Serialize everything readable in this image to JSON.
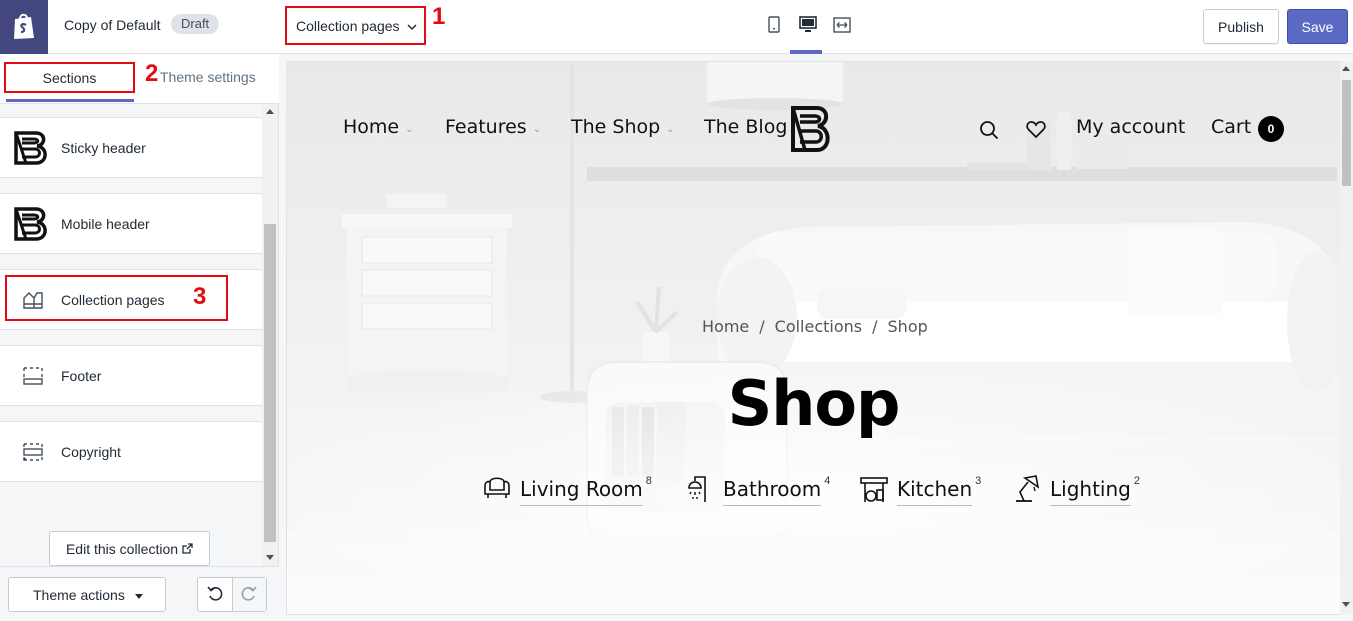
{
  "header": {
    "theme_name": "Copy of Default",
    "draft_label": "Draft",
    "page_selector": "Collection pages",
    "publish_label": "Publish",
    "save_label": "Save",
    "annotations": [
      "1",
      "2",
      "3"
    ],
    "icons": [
      "shopify-bag-icon",
      "mobile-view-icon",
      "desktop-view-icon",
      "fullscreen-view-icon"
    ]
  },
  "sidebar": {
    "tab_sections": "Sections",
    "tab_theme_settings": "Theme settings",
    "items": [
      {
        "label": "Sticky header",
        "icon": "brand-logo-icon"
      },
      {
        "label": "Mobile header",
        "icon": "brand-logo-icon"
      },
      {
        "label": "Collection pages",
        "icon": "collection-icon"
      },
      {
        "label": "Footer",
        "icon": "footer-icon"
      },
      {
        "label": "Copyright",
        "icon": "copyright-icon"
      }
    ],
    "edit_collection": "Edit this collection",
    "theme_actions": "Theme actions"
  },
  "preview": {
    "nav": [
      "Home",
      "Features",
      "The Shop",
      "The Blog"
    ],
    "my_account": "My account",
    "cart_label": "Cart",
    "cart_count": "0",
    "breadcrumb": [
      "Home",
      "/",
      "Collections",
      "/",
      "Shop"
    ],
    "title": "Shop",
    "categories": [
      {
        "name": "Living Room",
        "count": "8",
        "icon": "armchair-icon"
      },
      {
        "name": "Bathroom",
        "count": "4",
        "icon": "shower-icon"
      },
      {
        "name": "Kitchen",
        "count": "3",
        "icon": "kitchen-icon"
      },
      {
        "name": "Lighting",
        "count": "2",
        "icon": "lamp-icon"
      }
    ]
  },
  "colors": {
    "accent": "#5c6ac4",
    "annotation_red": "#e20b14",
    "logo_bg": "#43467f"
  }
}
